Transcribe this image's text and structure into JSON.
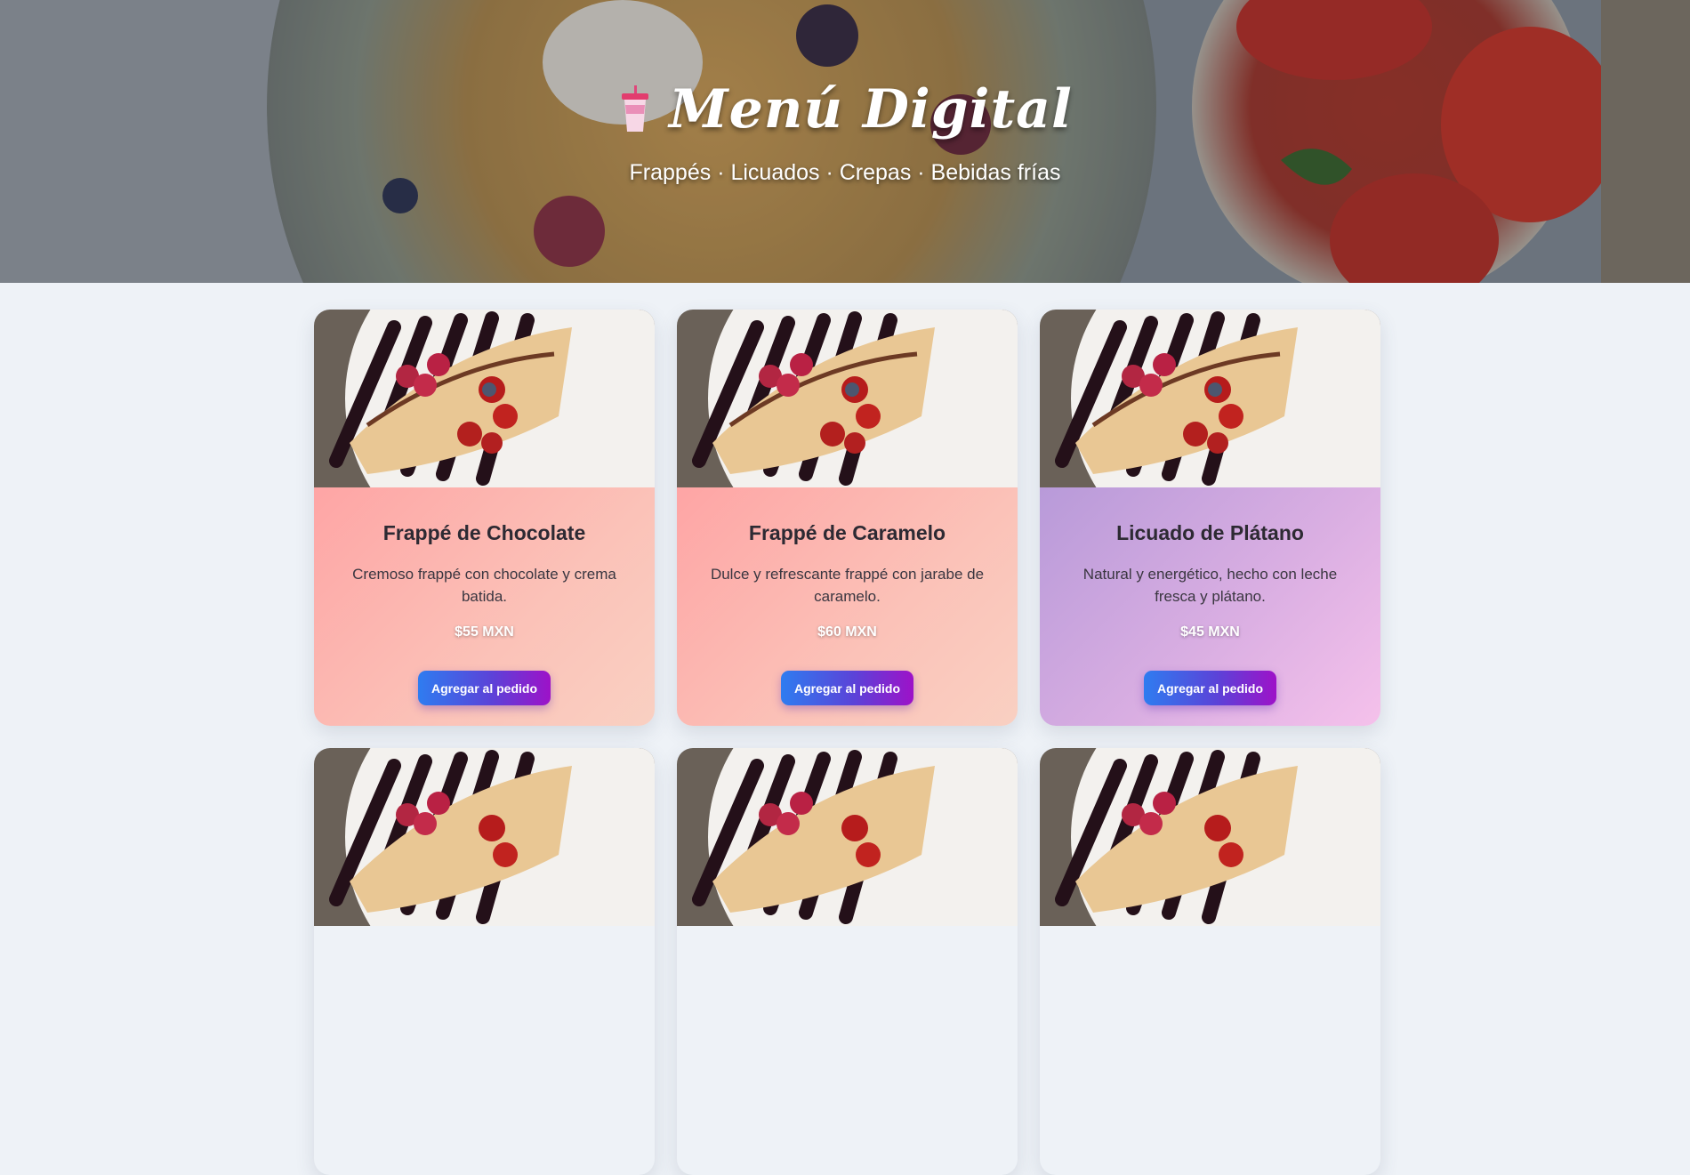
{
  "hero": {
    "title": "Menú Digital",
    "subtitle": "Frappés · Licuados · Crepas · Bebidas frías"
  },
  "products": [
    {
      "title": "Frappé de Chocolate",
      "description": "Cremoso frappé con chocolate y crema batida.",
      "price": "$55 MXN",
      "button": "Agregar al pedido",
      "theme": "pink"
    },
    {
      "title": "Frappé de Caramelo",
      "description": "Dulce y refrescante frappé con jarabe de caramelo.",
      "price": "$60 MXN",
      "button": "Agregar al pedido",
      "theme": "pink"
    },
    {
      "title": "Licuado de Plátano",
      "description": "Natural y energético, hecho con leche fresca y plátano.",
      "price": "$45 MXN",
      "button": "Agregar al pedido",
      "theme": "purple"
    }
  ],
  "colors": {
    "page_bg": "#eef2f7",
    "card_pink": "#fea5a5",
    "card_purple": "#b89ad9",
    "button_start": "#2f7cf0",
    "button_end": "#9d12c8"
  },
  "icons": {
    "hero_icon": "drink-cup-icon",
    "food_image": "crepe-with-berries-image"
  }
}
